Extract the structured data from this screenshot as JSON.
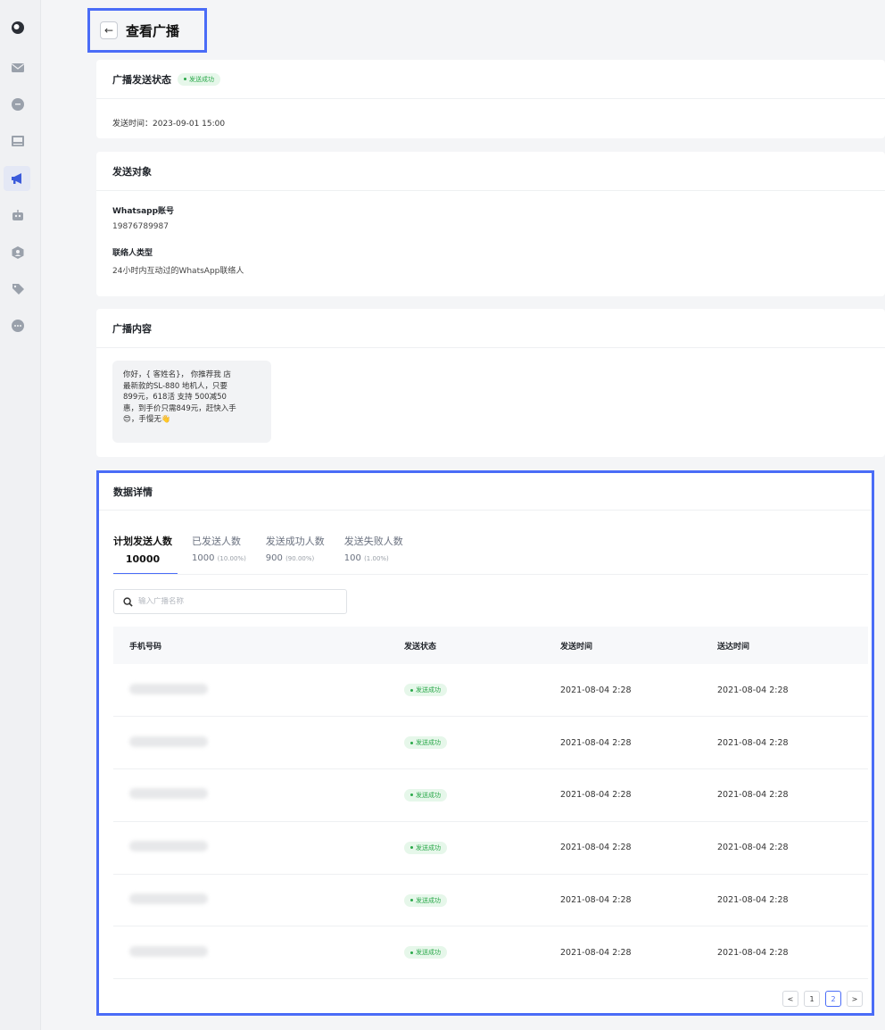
{
  "page": {
    "title": "查看广播",
    "back_icon": "arrow-left-icon"
  },
  "sidebar": {
    "items": [
      {
        "icon": "logo-icon"
      },
      {
        "icon": "mail-icon"
      },
      {
        "icon": "chat-icon"
      },
      {
        "icon": "image-icon"
      },
      {
        "icon": "megaphone-icon",
        "active": true
      },
      {
        "icon": "robot-icon"
      },
      {
        "icon": "contact-icon"
      },
      {
        "icon": "tag-icon"
      },
      {
        "icon": "more-icon"
      }
    ]
  },
  "status_card": {
    "title": "广播发送状态",
    "badge": "发送成功",
    "send_time": "发送时间：2023-09-01 15:00"
  },
  "target_card": {
    "title": "发送对象",
    "account_label": "Whatsapp账号",
    "account_value": "19876789987",
    "contact_type_label": "联络人类型",
    "contact_type_value": "24小时内互动过的WhatsApp联络人"
  },
  "content_card": {
    "title": "广播内容",
    "lines": [
      "你好，{ 客姓名}， 你推荐我 店",
      "最新款的SL-880 地机人，只要",
      "899元，618活  支持 500减50",
      "惠，到手价只需849元，赶快入手",
      "😍，手慢无👋"
    ]
  },
  "data_card": {
    "title": "数据详情",
    "tabs": [
      {
        "label": "计划发送人数",
        "value": "10000",
        "pct": ""
      },
      {
        "label": "已发送人数",
        "value": "1000",
        "pct": "(10.00%)"
      },
      {
        "label": "发送成功人数",
        "value": "900",
        "pct": "(90.00%)"
      },
      {
        "label": "发送失败人数",
        "value": "100",
        "pct": "(1.00%)"
      }
    ],
    "search_placeholder": "输入广播名称",
    "columns": [
      "手机号码",
      "发送状态",
      "发送时间",
      "送达时间"
    ],
    "rows": [
      {
        "status": "发送成功",
        "sent": "2021-08-04 2:28",
        "delivered": "2021-08-04 2:28"
      },
      {
        "status": "发送成功",
        "sent": "2021-08-04 2:28",
        "delivered": "2021-08-04 2:28"
      },
      {
        "status": "发送成功",
        "sent": "2021-08-04 2:28",
        "delivered": "2021-08-04 2:28"
      },
      {
        "status": "发送成功",
        "sent": "2021-08-04 2:28",
        "delivered": "2021-08-04 2:28"
      },
      {
        "status": "发送成功",
        "sent": "2021-08-04 2:28",
        "delivered": "2021-08-04 2:28"
      },
      {
        "status": "发送成功",
        "sent": "2021-08-04 2:28",
        "delivered": "2021-08-04 2:28"
      }
    ],
    "pagination": {
      "prev": "<",
      "pages": [
        "1",
        "2"
      ],
      "current": "2",
      "next": ">"
    }
  },
  "colors": {
    "accent": "#4a6cf7",
    "success_bg": "#e6f7ea",
    "success_text": "#2aa84a"
  }
}
